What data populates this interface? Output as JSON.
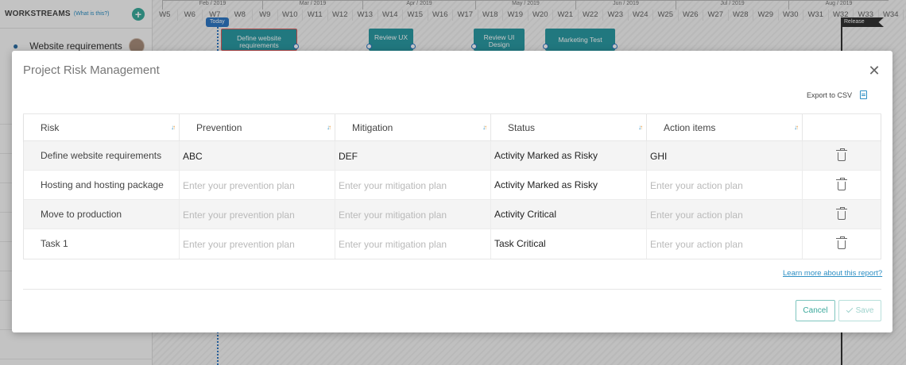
{
  "background": {
    "workstreams_title": "WORKSTREAMS",
    "workstreams_help": "(What is this?)",
    "add_symbol": "+",
    "workstream_name": "Website requirements",
    "months": [
      {
        "label": "Feb / 2019"
      },
      {
        "label": "Mar / 2019"
      },
      {
        "label": "Apr / 2019"
      },
      {
        "label": "May / 2019"
      },
      {
        "label": "Jun / 2019"
      },
      {
        "label": "Jul / 2019"
      },
      {
        "label": "Aug / 2019"
      }
    ],
    "weeks": [
      "W5",
      "W6",
      "W7",
      "W8",
      "W9",
      "W10",
      "W11",
      "W12",
      "W13",
      "W14",
      "W15",
      "W16",
      "W17",
      "W18",
      "W19",
      "W20",
      "W21",
      "W22",
      "W23",
      "W24",
      "W25",
      "W26",
      "W27",
      "W28",
      "W29",
      "W30",
      "W31",
      "W32",
      "W33",
      "W34"
    ],
    "today_label": "Today",
    "tasks": {
      "define": "Define website requirements",
      "review_ux": "Review UX",
      "review_ui": "Review UI Design",
      "marketing": "Marketing Test"
    },
    "release_label": "Release"
  },
  "modal": {
    "title": "Project Risk Management",
    "close_symbol": "✕",
    "export_label": "Export to CSV",
    "columns": {
      "risk": "Risk",
      "prevention": "Prevention",
      "mitigation": "Mitigation",
      "status": "Status",
      "action_items": "Action items"
    },
    "placeholders": {
      "prevention": "Enter your prevention plan",
      "mitigation": "Enter your mitigation plan",
      "action": "Enter your action plan"
    },
    "rows": [
      {
        "risk": "Define website requirements",
        "prevention": "ABC",
        "mitigation": "DEF",
        "status": "Activity Marked as Risky",
        "action": "GHI"
      },
      {
        "risk": "Hosting and hosting package",
        "prevention": "",
        "mitigation": "",
        "status": "Activity Marked as Risky",
        "action": ""
      },
      {
        "risk": "Move to production",
        "prevention": "",
        "mitigation": "",
        "status": "Activity Critical",
        "action": ""
      },
      {
        "risk": "Task 1",
        "prevention": "",
        "mitigation": "",
        "status": "Task Critical",
        "action": ""
      }
    ],
    "learn_more": "Learn more about this report?",
    "cancel_label": "Cancel",
    "save_label": "Save"
  }
}
